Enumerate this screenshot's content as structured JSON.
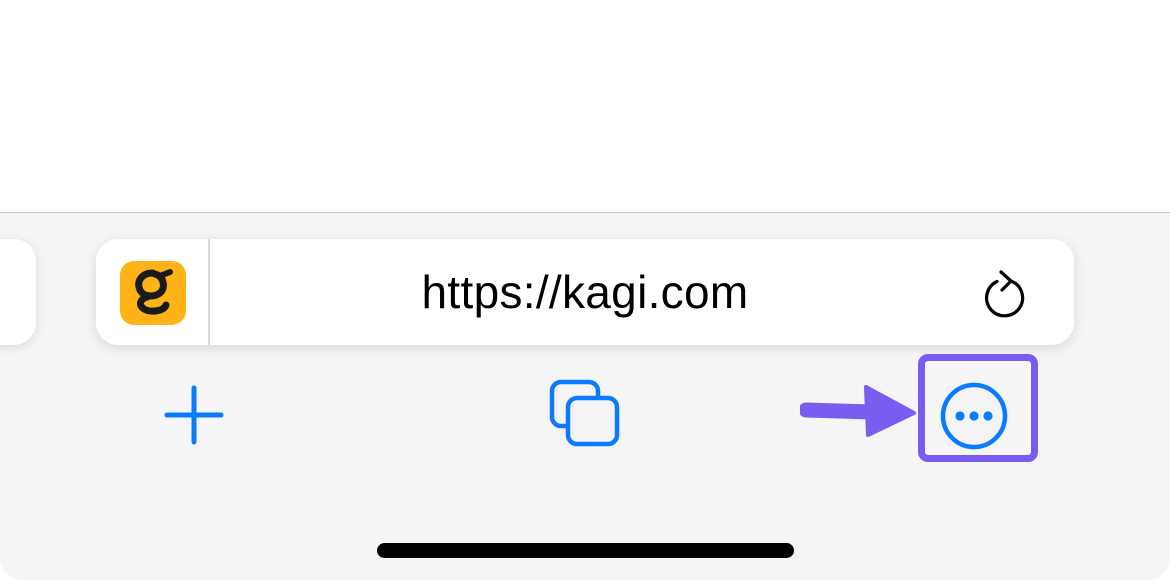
{
  "browser": {
    "url": "https://kagi.com",
    "favicon_letter": "g"
  },
  "icons": {
    "favicon": "kagi-logo-icon",
    "reload": "reload-icon",
    "new_tab": "plus-icon",
    "tabs": "tabs-overview-icon",
    "more": "ellipsis-circle-icon",
    "annotation_arrow": "arrow-right-icon"
  },
  "colors": {
    "accent": "#0a7aff",
    "annotation": "#7a5cf0",
    "favicon_bg": "#ffb319",
    "toolbar_bg": "#f5f5f7"
  }
}
